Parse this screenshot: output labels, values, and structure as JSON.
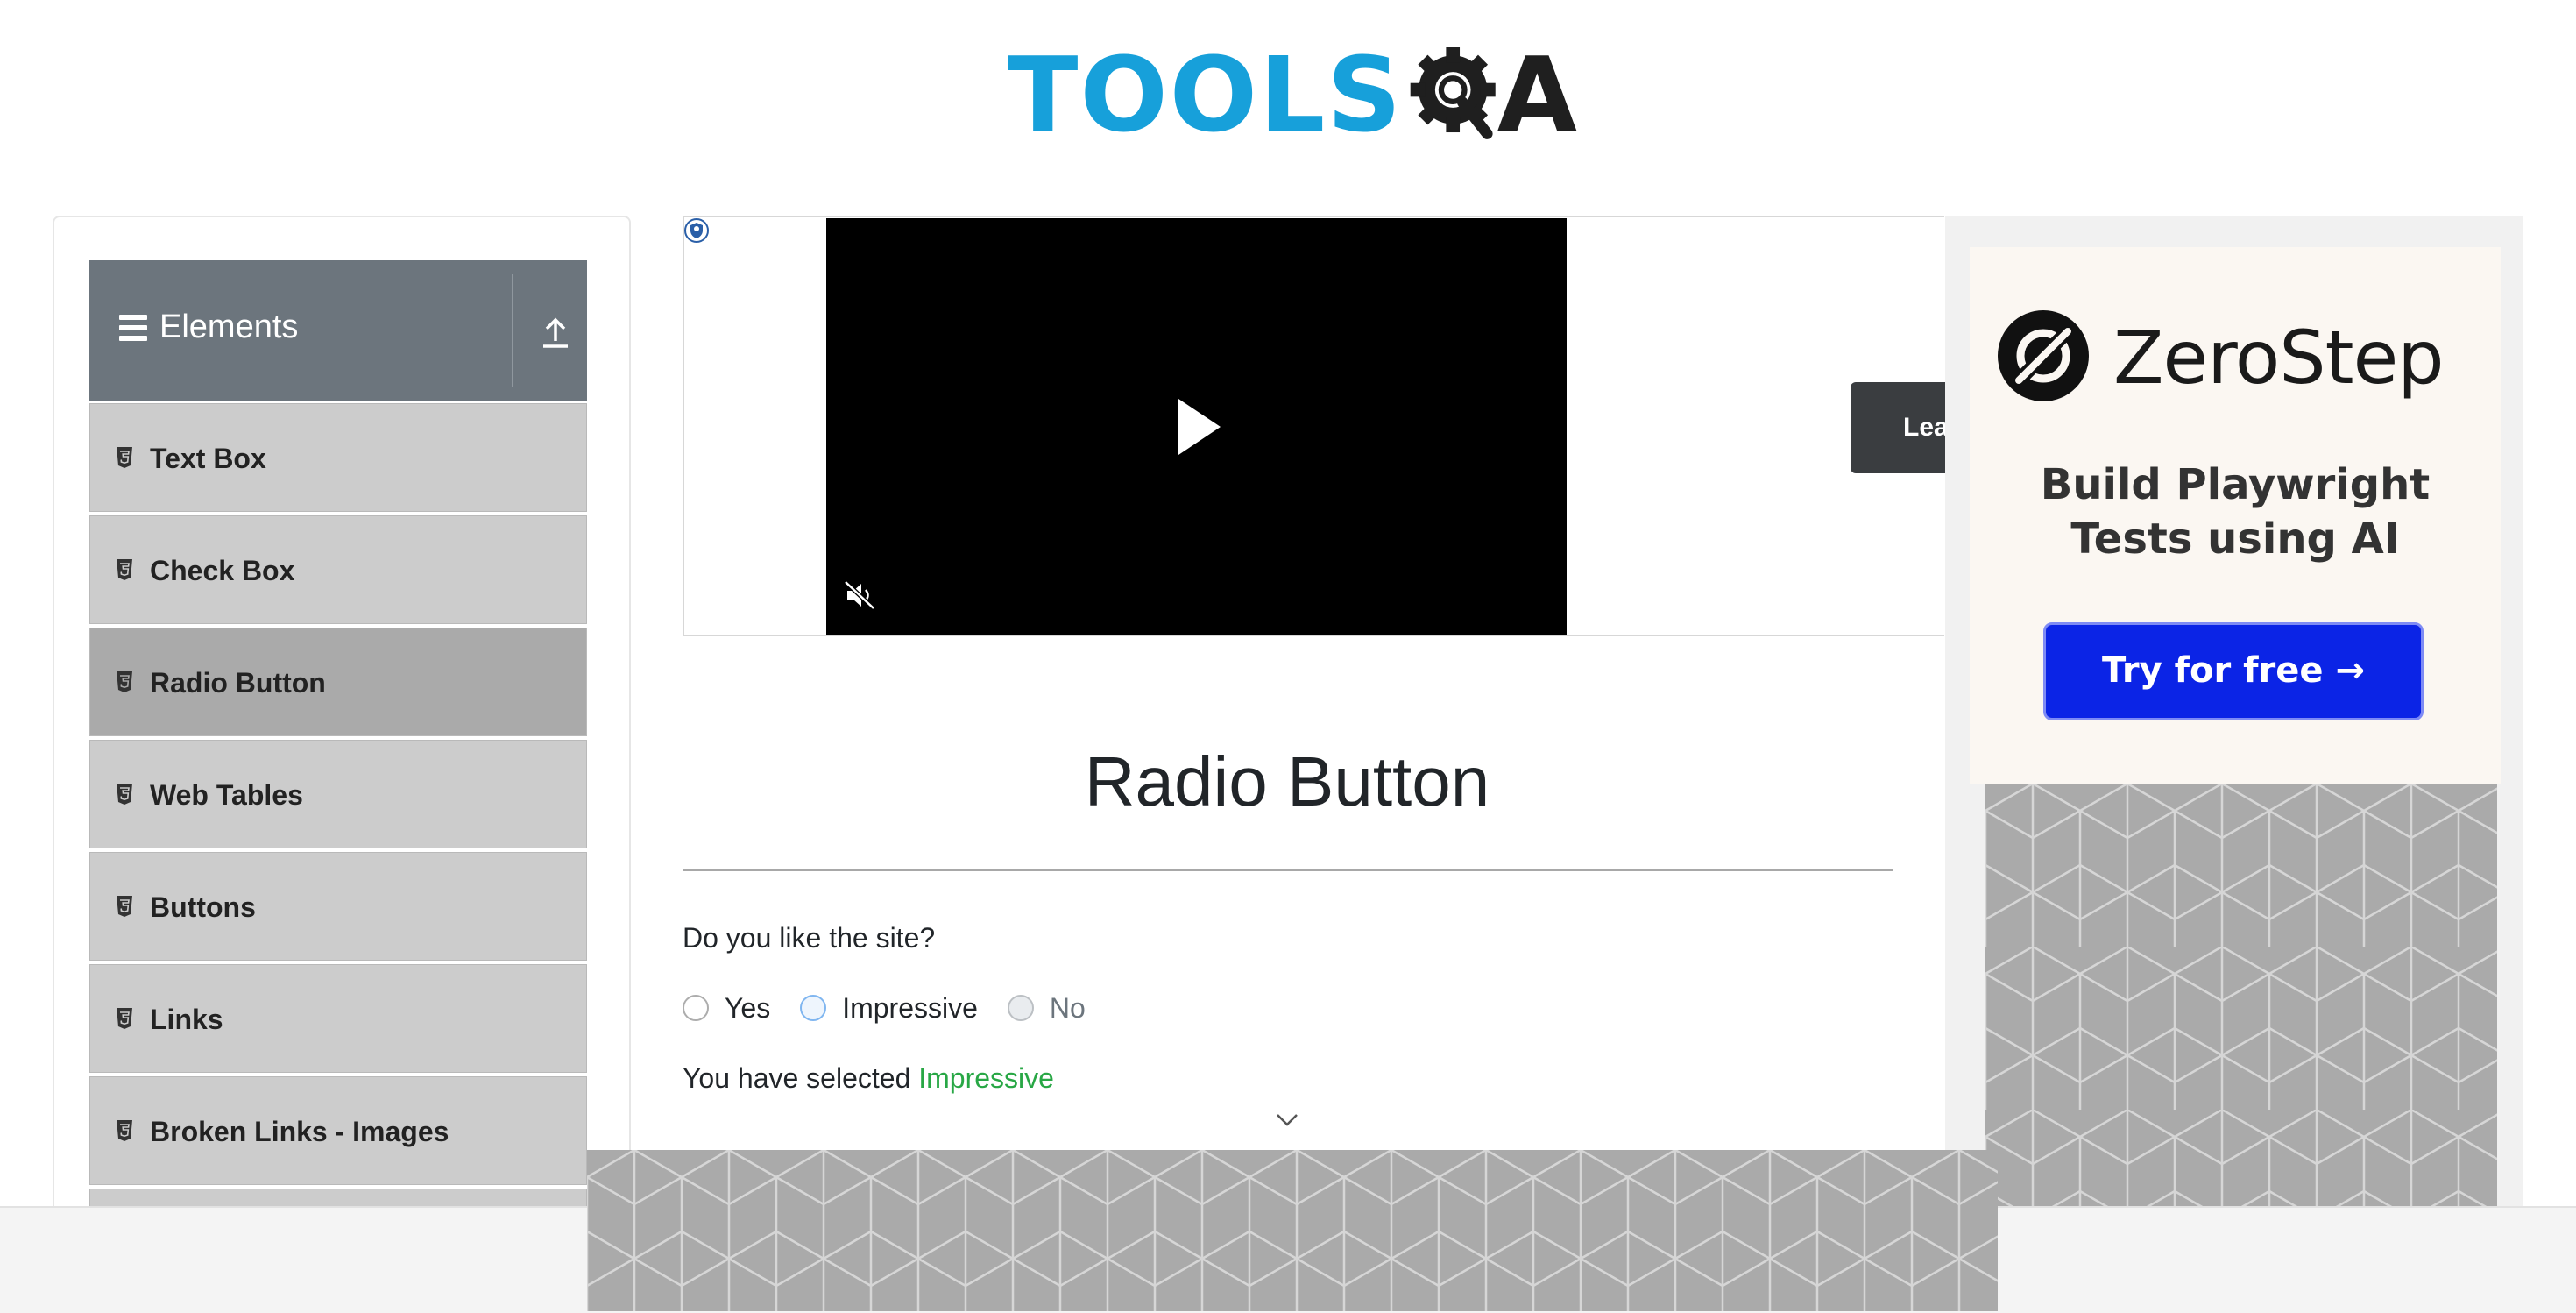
{
  "header": {
    "logo_text": "TOOLSQA",
    "logo_part1": "TOOLS",
    "logo_part2": "A"
  },
  "sidebar": {
    "group_title": "Elements",
    "items": [
      {
        "label": "Text Box",
        "active": false
      },
      {
        "label": "Check Box",
        "active": false
      },
      {
        "label": "Radio Button",
        "active": true
      },
      {
        "label": "Web Tables",
        "active": false
      },
      {
        "label": "Buttons",
        "active": false
      },
      {
        "label": "Links",
        "active": false
      },
      {
        "label": "Broken Links - Images",
        "active": false
      },
      {
        "label": "",
        "active": false
      }
    ]
  },
  "video_ad": {
    "button_label": "Lea",
    "state": "paused",
    "muted": true
  },
  "main": {
    "title": "Radio Button",
    "question": "Do you like the site?",
    "options": [
      {
        "label": "Yes",
        "state": "unchecked"
      },
      {
        "label": "Impressive",
        "state": "selected"
      },
      {
        "label": "No",
        "state": "disabled"
      }
    ],
    "result_prefix": "You have selected",
    "result_value": "Impressive"
  },
  "right_ad": {
    "brand": "ZeroStep",
    "tagline_line1": "Build Playwright",
    "tagline_line2": "Tests using AI",
    "cta": "Try for free →"
  },
  "colors": {
    "logo_blue": "#17a0da",
    "sidebar_header": "#6c757d",
    "menu_item": "#cccccc",
    "menu_item_active": "#aaaaaa",
    "success_green": "#28a745",
    "cta_blue": "#0b24e6"
  },
  "icons": [
    "gear-magnifier-logo",
    "hamburger-icon",
    "upload-arrow-icon",
    "html5-icon",
    "adchoices-icon",
    "play-icon",
    "muted-speaker-icon",
    "chevron-down-icon",
    "zerostep-logo-icon"
  ]
}
